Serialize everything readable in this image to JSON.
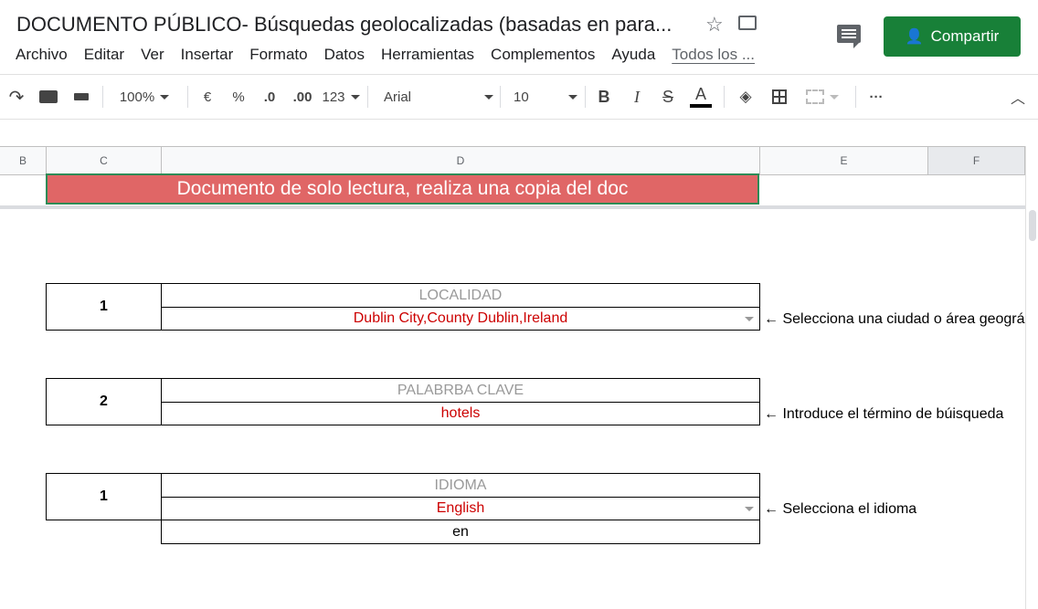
{
  "title": "DOCUMENTO PÚBLICO- Búsquedas geolocalizadas (basadas en para...",
  "menu": [
    "Archivo",
    "Editar",
    "Ver",
    "Insertar",
    "Formato",
    "Datos",
    "Herramientas",
    "Complementos",
    "Ayuda",
    "Todos los ..."
  ],
  "share_label": "Compartir",
  "toolbar": {
    "zoom": "100%",
    "currency": "€",
    "percent": "%",
    "dec_less": ".0",
    "dec_more": ".00",
    "format": "123",
    "font": "Arial",
    "size": "10",
    "bold": "B",
    "italic": "I",
    "strike": "S",
    "textcolor": "A",
    "more": "···"
  },
  "columns": [
    "B",
    "C",
    "D",
    "E",
    "F"
  ],
  "banner": "Documento de solo lectura, realiza una copia del doc",
  "blocks": [
    {
      "number": "1",
      "label": "LOCALIDAD",
      "value": "Dublin City,County Dublin,Ireland",
      "note": "← Selecciona una ciudad o área geográ"
    },
    {
      "number": "2",
      "label": "PALABRBA CLAVE",
      "value": "hotels",
      "note": "← Introduce el término de búisqueda"
    },
    {
      "number": "1",
      "label": "IDIOMA",
      "value": "English",
      "extra": "en",
      "note": "← Selecciona el idioma"
    }
  ],
  "colors": {
    "share": "#188038",
    "banner": "#e06666",
    "value": "#cc0000"
  }
}
